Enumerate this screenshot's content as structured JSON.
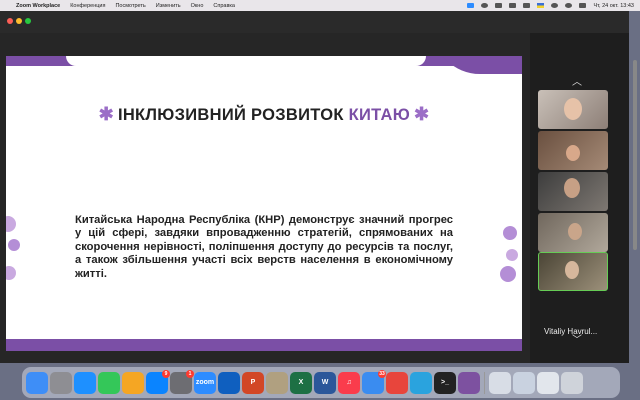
{
  "menubar": {
    "apple": "",
    "app_name": "Zoom Workplace",
    "items": [
      "Конференция",
      "Посмотреть",
      "Изменить",
      "Окно",
      "Справка"
    ],
    "clock": "Чт, 24 окт.  13:43"
  },
  "slide": {
    "title_main": "ІНКЛЮЗИВНИЙ РОЗВИТОК ",
    "title_accent": "КИТАЮ",
    "star": "✱",
    "body": "Китайська Народна Республіка (КНР) демонструє значний прогрес у цій сфері, завдяки впровадженню стратегій, спрямованих на скорочення нерівності, поліпшення доступу до ресурсів та послуг, а також збільшення участі всіх верств населення в економічному житті.",
    "colors": {
      "accent": "#7b4fa6",
      "light": "#c9a9e0"
    }
  },
  "participants": {
    "chevron_up": "︿",
    "chevron_down": "﹀",
    "active_name": "Vitaliy Havrul..."
  },
  "dock": {
    "apps": [
      {
        "icon": "finder-icon",
        "label": "",
        "color": "#3e8ef7"
      },
      {
        "icon": "launchpad-icon",
        "label": "",
        "color": "#8e8e93"
      },
      {
        "icon": "safari-icon",
        "label": "",
        "color": "#1e90ff"
      },
      {
        "icon": "facetime-icon",
        "label": "",
        "color": "#34c759"
      },
      {
        "icon": "photos-icon",
        "label": "",
        "color": "#f5a623"
      },
      {
        "icon": "appstore-icon",
        "label": "",
        "color": "#0a84ff",
        "badge": "9"
      },
      {
        "icon": "settings-icon",
        "label": "",
        "color": "#6d6d72",
        "badge": "1"
      },
      {
        "icon": "zoom-icon",
        "label": "zoom",
        "color": "#2d8cff"
      },
      {
        "icon": "outlook-icon",
        "label": "",
        "color": "#0f5fbf"
      },
      {
        "icon": "powerpoint-icon",
        "label": "P",
        "color": "#d24726"
      },
      {
        "icon": "preview-icon",
        "label": "",
        "color": "#b0a080"
      },
      {
        "icon": "excel-icon",
        "label": "X",
        "color": "#1d7044"
      },
      {
        "icon": "word-icon",
        "label": "W",
        "color": "#2b579a"
      },
      {
        "icon": "music-icon",
        "label": "♫",
        "color": "#fa3c4c"
      },
      {
        "icon": "mail-icon",
        "label": "",
        "color": "#3a8cf0",
        "badge": "33"
      },
      {
        "icon": "chrome-icon",
        "label": "",
        "color": "#e8453c"
      },
      {
        "icon": "telegram-icon",
        "label": "",
        "color": "#2aa3de"
      },
      {
        "icon": "terminal-icon",
        "label": ">_",
        "color": "#222222"
      },
      {
        "icon": "viber-icon",
        "label": "",
        "color": "#7d51a0"
      },
      {
        "icon": "files-icon",
        "label": "",
        "color": "#d8dde6"
      },
      {
        "icon": "files2-icon",
        "label": "",
        "color": "#c9d2e0"
      },
      {
        "icon": "files3-icon",
        "label": "",
        "color": "#e2e6ec"
      },
      {
        "icon": "trash-icon",
        "label": "",
        "color": "#cfd3da"
      }
    ]
  }
}
